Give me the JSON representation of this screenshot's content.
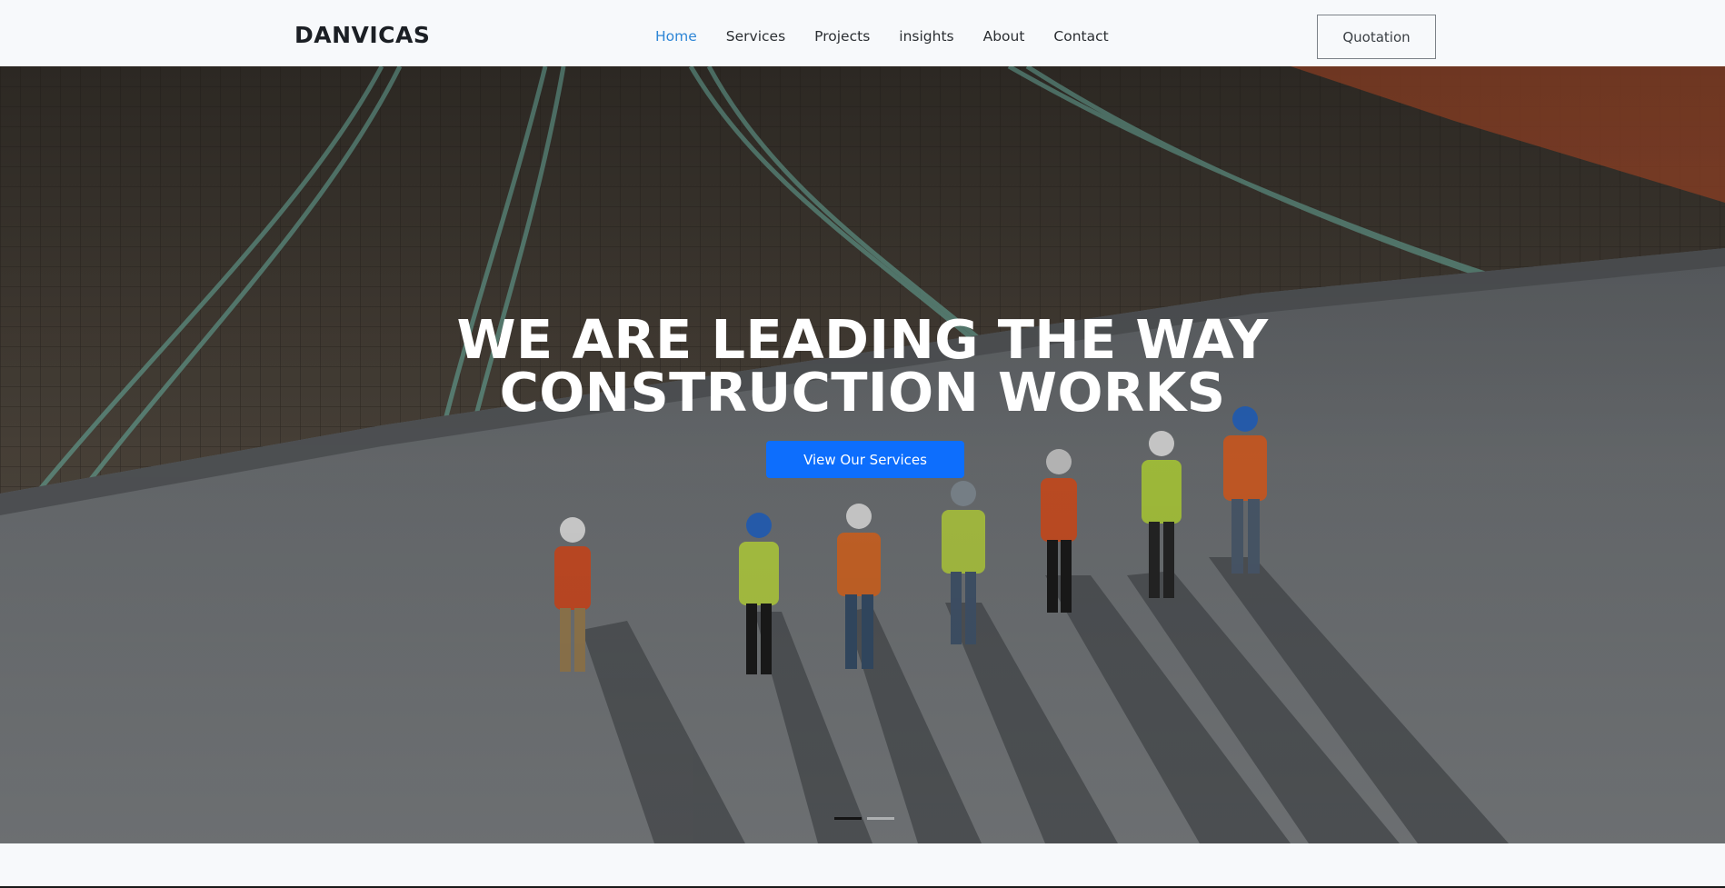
{
  "brand": {
    "name": "DANVICAS"
  },
  "nav": {
    "items": [
      {
        "label": "Home",
        "active": true
      },
      {
        "label": "Services",
        "active": false
      },
      {
        "label": "Projects",
        "active": false
      },
      {
        "label": "insights",
        "active": false
      },
      {
        "label": "About",
        "active": false
      },
      {
        "label": "Contact",
        "active": false
      }
    ],
    "quotation_label": "Quotation"
  },
  "hero": {
    "title_line1": "WE ARE LEADING THE WAY",
    "title_line2": "CONSTRUCTION WORKS",
    "cta_label": "View Our Services",
    "carousel": {
      "slides": 2,
      "active_index": 0
    }
  },
  "colors": {
    "accent": "#0d6efd",
    "nav_active": "#2e86d6",
    "header_bg": "#f7f9fb"
  }
}
